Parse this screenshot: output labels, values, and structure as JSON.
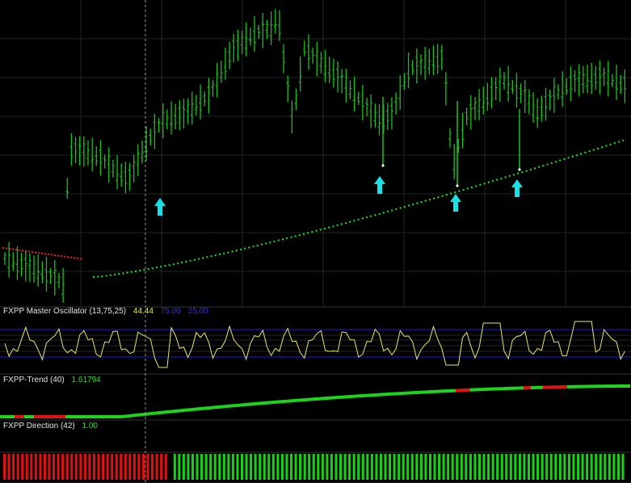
{
  "colors": {
    "background": "#000000",
    "grid": "#1c2a1c",
    "candle": "#19c21b",
    "ma_dot_up": "#22d422",
    "ma_dot_down": "#e02020",
    "oscillator_line": "#e8e86a",
    "oscillator_levels": "#1b1bd8",
    "trend_up": "#1ed61e",
    "trend_down": "#e01414",
    "direction_up": "#17d117",
    "direction_down": "#e01010",
    "arrow": "#19e0e6",
    "label": "#e6e6e6",
    "value_yellow": "#e8e84c",
    "value_blue": "#2c2cff",
    "value_green": "#2ae02a",
    "crosshair": "#9a9a9a"
  },
  "panels": {
    "oscillator": {
      "name": "FXPP Master Oscillator (13,75,25)",
      "value": "44.44",
      "upper_level": "75.00",
      "lower_level": "25.00"
    },
    "trend": {
      "name": "FXPP-Trend (40)",
      "value": "1.61794"
    },
    "direction": {
      "name": "FXPP Direction (42)",
      "value": "1.00"
    }
  },
  "chart_data": {
    "type": "ohlc",
    "signals": [
      {
        "type": "buy-arrow",
        "bar": 23
      },
      {
        "type": "buy-arrow",
        "bar": 55
      },
      {
        "type": "buy-arrow",
        "bar": 65
      },
      {
        "type": "buy-arrow",
        "bar": 74
      }
    ],
    "direction_down_bars": 37,
    "direction_total_bars": 139
  }
}
